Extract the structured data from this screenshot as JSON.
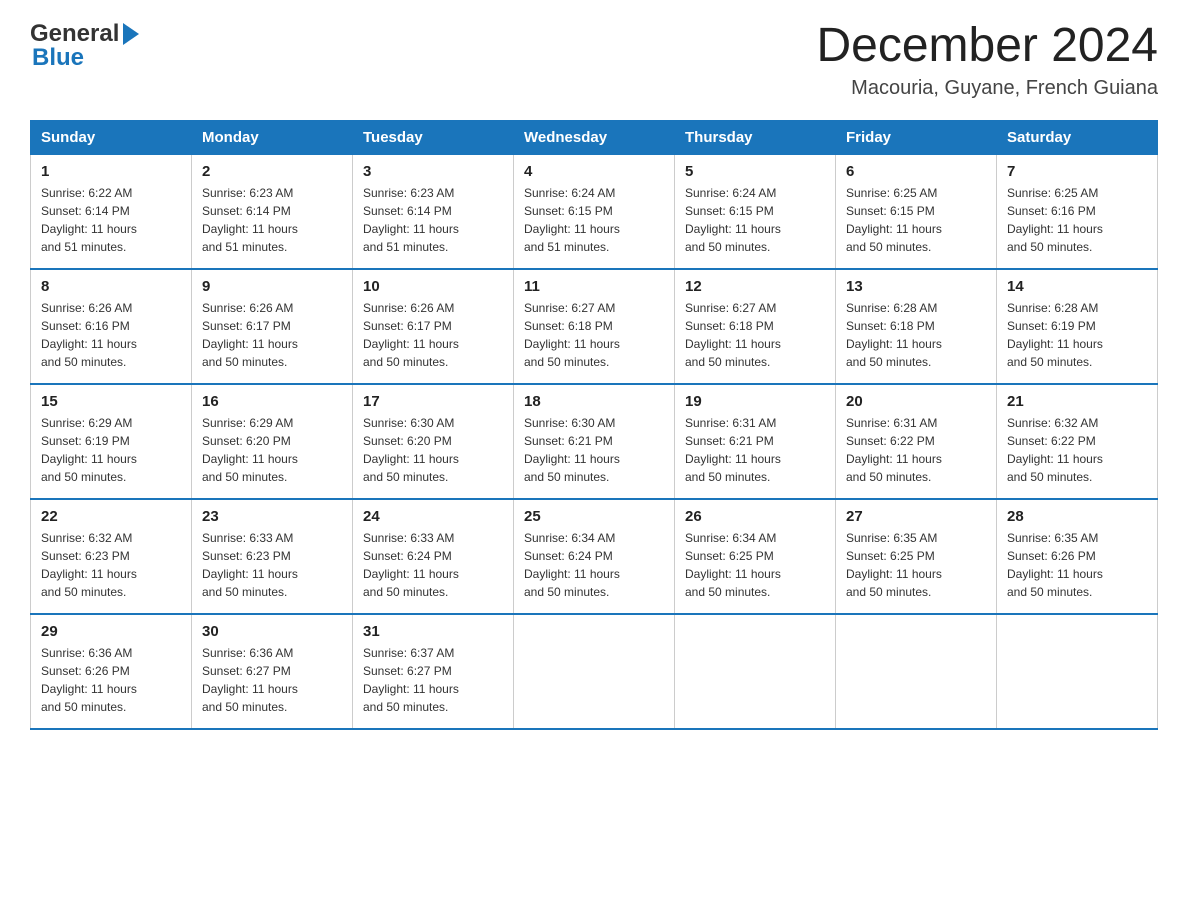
{
  "header": {
    "logo_general": "General",
    "logo_blue": "Blue",
    "month_title": "December 2024",
    "location": "Macouria, Guyane, French Guiana"
  },
  "days_of_week": [
    "Sunday",
    "Monday",
    "Tuesday",
    "Wednesday",
    "Thursday",
    "Friday",
    "Saturday"
  ],
  "weeks": [
    [
      {
        "day": "1",
        "sunrise": "6:22 AM",
        "sunset": "6:14 PM",
        "daylight": "11 hours and 51 minutes."
      },
      {
        "day": "2",
        "sunrise": "6:23 AM",
        "sunset": "6:14 PM",
        "daylight": "11 hours and 51 minutes."
      },
      {
        "day": "3",
        "sunrise": "6:23 AM",
        "sunset": "6:14 PM",
        "daylight": "11 hours and 51 minutes."
      },
      {
        "day": "4",
        "sunrise": "6:24 AM",
        "sunset": "6:15 PM",
        "daylight": "11 hours and 51 minutes."
      },
      {
        "day": "5",
        "sunrise": "6:24 AM",
        "sunset": "6:15 PM",
        "daylight": "11 hours and 50 minutes."
      },
      {
        "day": "6",
        "sunrise": "6:25 AM",
        "sunset": "6:15 PM",
        "daylight": "11 hours and 50 minutes."
      },
      {
        "day": "7",
        "sunrise": "6:25 AM",
        "sunset": "6:16 PM",
        "daylight": "11 hours and 50 minutes."
      }
    ],
    [
      {
        "day": "8",
        "sunrise": "6:26 AM",
        "sunset": "6:16 PM",
        "daylight": "11 hours and 50 minutes."
      },
      {
        "day": "9",
        "sunrise": "6:26 AM",
        "sunset": "6:17 PM",
        "daylight": "11 hours and 50 minutes."
      },
      {
        "day": "10",
        "sunrise": "6:26 AM",
        "sunset": "6:17 PM",
        "daylight": "11 hours and 50 minutes."
      },
      {
        "day": "11",
        "sunrise": "6:27 AM",
        "sunset": "6:18 PM",
        "daylight": "11 hours and 50 minutes."
      },
      {
        "day": "12",
        "sunrise": "6:27 AM",
        "sunset": "6:18 PM",
        "daylight": "11 hours and 50 minutes."
      },
      {
        "day": "13",
        "sunrise": "6:28 AM",
        "sunset": "6:18 PM",
        "daylight": "11 hours and 50 minutes."
      },
      {
        "day": "14",
        "sunrise": "6:28 AM",
        "sunset": "6:19 PM",
        "daylight": "11 hours and 50 minutes."
      }
    ],
    [
      {
        "day": "15",
        "sunrise": "6:29 AM",
        "sunset": "6:19 PM",
        "daylight": "11 hours and 50 minutes."
      },
      {
        "day": "16",
        "sunrise": "6:29 AM",
        "sunset": "6:20 PM",
        "daylight": "11 hours and 50 minutes."
      },
      {
        "day": "17",
        "sunrise": "6:30 AM",
        "sunset": "6:20 PM",
        "daylight": "11 hours and 50 minutes."
      },
      {
        "day": "18",
        "sunrise": "6:30 AM",
        "sunset": "6:21 PM",
        "daylight": "11 hours and 50 minutes."
      },
      {
        "day": "19",
        "sunrise": "6:31 AM",
        "sunset": "6:21 PM",
        "daylight": "11 hours and 50 minutes."
      },
      {
        "day": "20",
        "sunrise": "6:31 AM",
        "sunset": "6:22 PM",
        "daylight": "11 hours and 50 minutes."
      },
      {
        "day": "21",
        "sunrise": "6:32 AM",
        "sunset": "6:22 PM",
        "daylight": "11 hours and 50 minutes."
      }
    ],
    [
      {
        "day": "22",
        "sunrise": "6:32 AM",
        "sunset": "6:23 PM",
        "daylight": "11 hours and 50 minutes."
      },
      {
        "day": "23",
        "sunrise": "6:33 AM",
        "sunset": "6:23 PM",
        "daylight": "11 hours and 50 minutes."
      },
      {
        "day": "24",
        "sunrise": "6:33 AM",
        "sunset": "6:24 PM",
        "daylight": "11 hours and 50 minutes."
      },
      {
        "day": "25",
        "sunrise": "6:34 AM",
        "sunset": "6:24 PM",
        "daylight": "11 hours and 50 minutes."
      },
      {
        "day": "26",
        "sunrise": "6:34 AM",
        "sunset": "6:25 PM",
        "daylight": "11 hours and 50 minutes."
      },
      {
        "day": "27",
        "sunrise": "6:35 AM",
        "sunset": "6:25 PM",
        "daylight": "11 hours and 50 minutes."
      },
      {
        "day": "28",
        "sunrise": "6:35 AM",
        "sunset": "6:26 PM",
        "daylight": "11 hours and 50 minutes."
      }
    ],
    [
      {
        "day": "29",
        "sunrise": "6:36 AM",
        "sunset": "6:26 PM",
        "daylight": "11 hours and 50 minutes."
      },
      {
        "day": "30",
        "sunrise": "6:36 AM",
        "sunset": "6:27 PM",
        "daylight": "11 hours and 50 minutes."
      },
      {
        "day": "31",
        "sunrise": "6:37 AM",
        "sunset": "6:27 PM",
        "daylight": "11 hours and 50 minutes."
      },
      null,
      null,
      null,
      null
    ]
  ],
  "labels": {
    "sunrise": "Sunrise:",
    "sunset": "Sunset:",
    "daylight": "Daylight:"
  }
}
